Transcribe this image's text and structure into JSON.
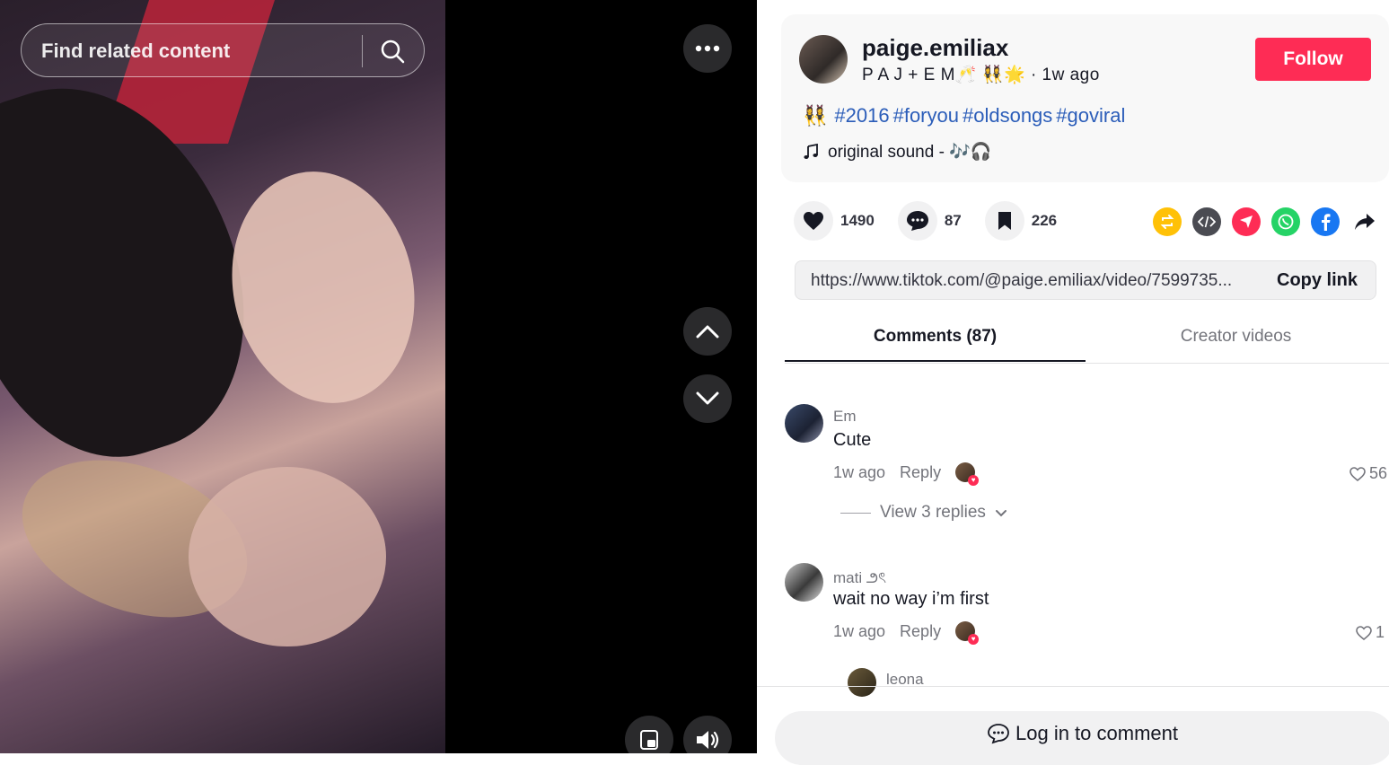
{
  "search": {
    "placeholder": "Find related content"
  },
  "author": {
    "username": "paige.emiliax",
    "nickname": "P A J + E M🥂 👯‍♀️🌟",
    "posted": "· 1w ago",
    "follow_label": "Follow"
  },
  "caption": {
    "emoji": "👯‍♀️",
    "hashtags": [
      "#2016",
      "#foryou",
      "#oldsongs",
      "#goviral"
    ]
  },
  "sound": {
    "label": "original sound - 🎶🎧"
  },
  "stats": {
    "likes": "1490",
    "comments": "87",
    "saves": "226"
  },
  "share_icons": [
    "repost-icon",
    "embed-icon",
    "send-icon",
    "whatsapp-icon",
    "facebook-icon",
    "share-arrow-icon"
  ],
  "link": {
    "url": "https://www.tiktok.com/@paige.emiliax/video/7599735...",
    "copy_label": "Copy link"
  },
  "tabs": {
    "comments": "Comments (87)",
    "creator": "Creator videos"
  },
  "comments": [
    {
      "name": "Em",
      "text": "Cute",
      "time": "1w ago",
      "reply": "Reply",
      "likes": "56"
    },
    {
      "name": "mati ౨ৎ",
      "text": "wait no way i’m first",
      "time": "1w ago",
      "reply": "Reply",
      "likes": "1"
    },
    {
      "name": "leona"
    }
  ],
  "replies": {
    "label": "View 3 replies"
  },
  "login": {
    "label": "Log in to comment"
  },
  "colors": {
    "accent": "#fe2c55",
    "hashtag": "#2b5db9",
    "text": "#161823",
    "muted": "#73747b"
  }
}
